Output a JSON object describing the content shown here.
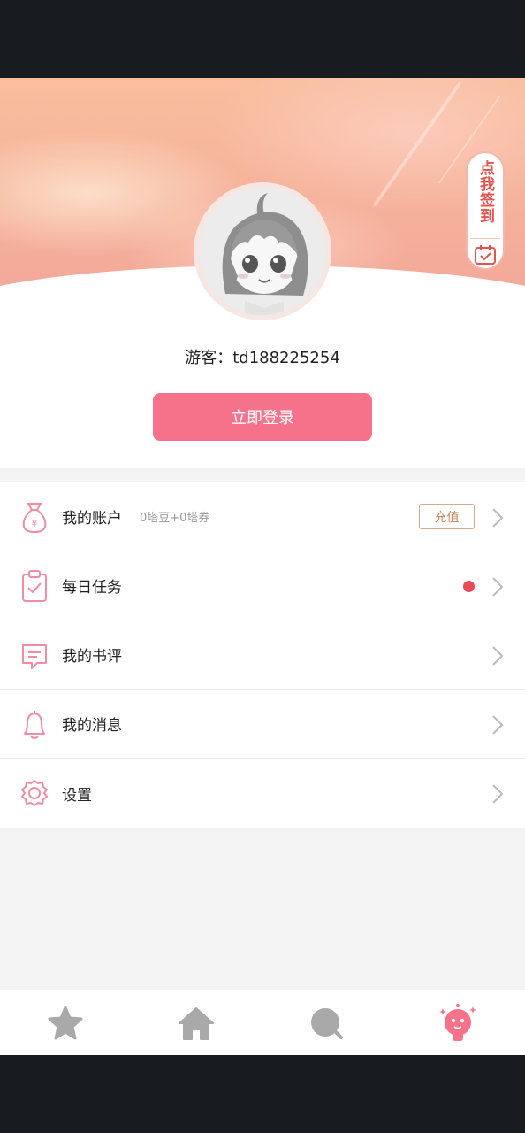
{
  "profile": {
    "guest_label": "游客：td188225254",
    "login_button": "立即登录",
    "signin_badge": "点我签到"
  },
  "menu": {
    "items": [
      {
        "label": "我的账户",
        "sub": "0塔豆+0塔券",
        "action": "充值",
        "icon": "money-bag-icon"
      },
      {
        "label": "每日任务",
        "has_dot": true,
        "icon": "clipboard-check-icon"
      },
      {
        "label": "我的书评",
        "icon": "comment-icon"
      },
      {
        "label": "我的消息",
        "icon": "bell-icon"
      },
      {
        "label": "设置",
        "icon": "gear-icon"
      }
    ]
  },
  "tabbar": {
    "tabs": [
      {
        "icon": "star-icon",
        "active": false
      },
      {
        "icon": "home-icon",
        "active": false
      },
      {
        "icon": "search-icon",
        "active": false
      },
      {
        "icon": "mascot-icon",
        "active": true
      }
    ]
  },
  "colors": {
    "accent": "#f6728a",
    "icon_pink": "#f08da0",
    "red_dot": "#ea4a55",
    "signin_red": "#e8524c",
    "recharge_border": "#d9a98c"
  }
}
